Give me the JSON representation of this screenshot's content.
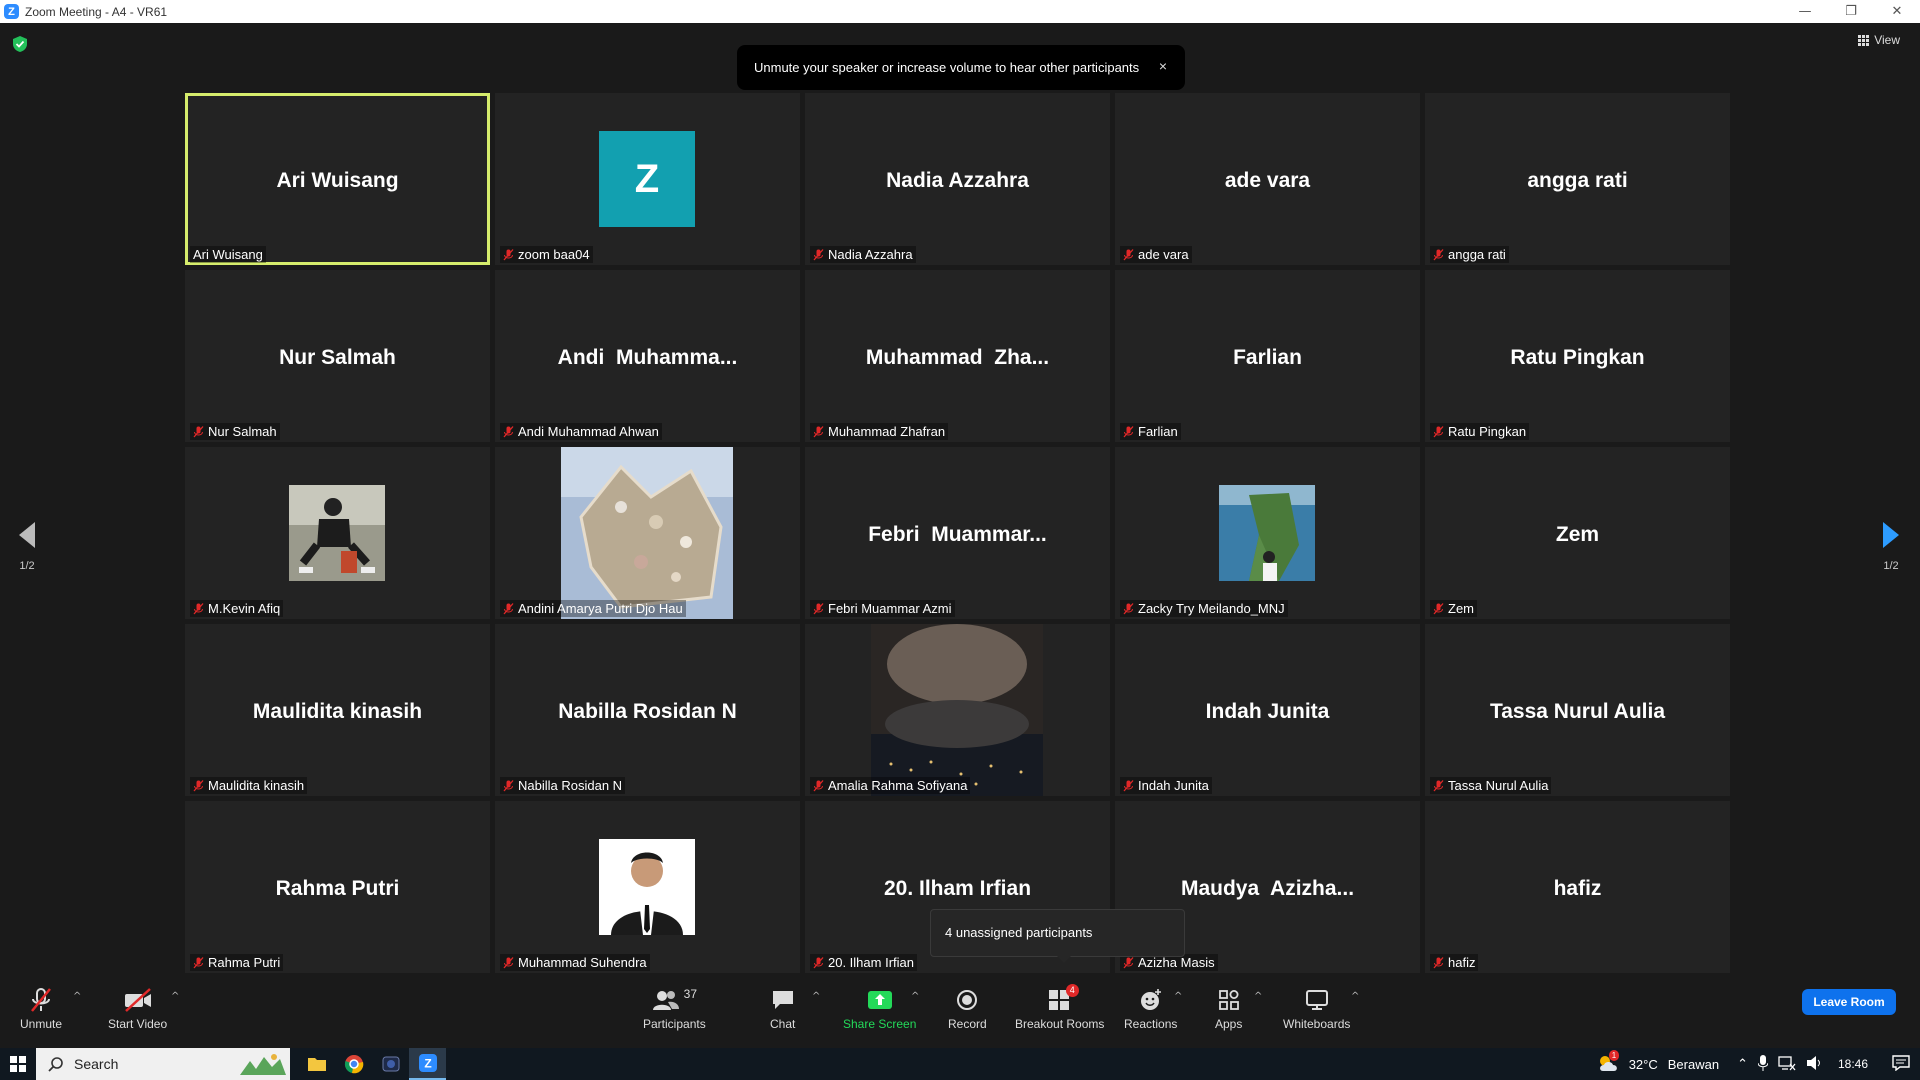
{
  "window": {
    "title": "Zoom Meeting - A4 - VR61",
    "controls": [
      "minimize",
      "restore",
      "close"
    ]
  },
  "view_button": {
    "label": "View"
  },
  "toast": {
    "message": "Unmute your speaker or increase volume to hear other participants",
    "close_glyph": "×"
  },
  "pager": {
    "left": "1/2",
    "right": "1/2"
  },
  "tiles": [
    {
      "display": "Ari Wuisang",
      "label": "Ari Wuisang",
      "muted": false,
      "active": true,
      "kind": "name"
    },
    {
      "display": "Z",
      "label": "zoom baa04",
      "muted": true,
      "kind": "letter"
    },
    {
      "display": "Nadia Azzahra",
      "label": "Nadia Azzahra",
      "muted": true,
      "kind": "name"
    },
    {
      "display": "ade vara",
      "label": "ade vara",
      "muted": true,
      "kind": "name"
    },
    {
      "display": "angga rati",
      "label": "angga rati",
      "muted": true,
      "kind": "name"
    },
    {
      "display": "Nur Salmah",
      "label": "Nur Salmah",
      "muted": true,
      "kind": "name"
    },
    {
      "display": "Andi  Muhamma...",
      "label": "Andi Muhammad Ahwan",
      "muted": true,
      "kind": "name"
    },
    {
      "display": "Muhammad  Zha...",
      "label": "Muhammad Zhafran",
      "muted": true,
      "kind": "name"
    },
    {
      "display": "Farlian",
      "label": "Farlian",
      "muted": true,
      "kind": "name"
    },
    {
      "display": "Ratu Pingkan",
      "label": "Ratu Pingkan",
      "muted": true,
      "kind": "name"
    },
    {
      "display": "",
      "label": "M.Kevin Afiq",
      "muted": true,
      "kind": "photo",
      "photo": "person-sitting"
    },
    {
      "display": "",
      "label": "Andini Amarya Putri Djo Hau",
      "muted": true,
      "kind": "photo",
      "photo": "crown"
    },
    {
      "display": "Febri  Muammar...",
      "label": "Febri Muammar Azmi",
      "muted": true,
      "kind": "name"
    },
    {
      "display": "",
      "label": "Zacky Try Meilando_MNJ",
      "muted": true,
      "kind": "photo",
      "photo": "cliff"
    },
    {
      "display": "Zem",
      "label": "Zem",
      "muted": true,
      "kind": "name"
    },
    {
      "display": "Maulidita kinasih",
      "label": "Maulidita kinasih",
      "muted": true,
      "kind": "name"
    },
    {
      "display": "Nabilla Rosidan N",
      "label": "Nabilla Rosidan N",
      "muted": true,
      "kind": "name"
    },
    {
      "display": "",
      "label": "Amalia Rahma Sofiyana",
      "muted": true,
      "kind": "photo",
      "photo": "night-city"
    },
    {
      "display": "Indah Junita",
      "label": "Indah Junita",
      "muted": true,
      "kind": "name"
    },
    {
      "display": "Tassa Nurul Aulia",
      "label": "Tassa Nurul Aulia",
      "muted": true,
      "kind": "name"
    },
    {
      "display": "Rahma Putri",
      "label": "Rahma Putri",
      "muted": true,
      "kind": "name"
    },
    {
      "display": "",
      "label": "Muhammad Suhendra",
      "muted": true,
      "kind": "photo",
      "photo": "portrait-suit"
    },
    {
      "display": "20. Ilham Irfian",
      "label": "20. Ilham Irfian",
      "muted": true,
      "kind": "name"
    },
    {
      "display": "Maudya  Azizha...",
      "label": "Azizha Masis",
      "muted": true,
      "kind": "name"
    },
    {
      "display": "hafiz",
      "label": "hafiz",
      "muted": true,
      "kind": "name"
    }
  ],
  "tooltip": {
    "text": "4 unassigned participants"
  },
  "toolbar": {
    "unmute": "Unmute",
    "start_video": "Start Video",
    "participants": "Participants",
    "participants_count": "37",
    "chat": "Chat",
    "share_screen": "Share Screen",
    "record": "Record",
    "breakout_rooms": "Breakout Rooms",
    "breakout_badge": "4",
    "reactions": "Reactions",
    "apps": "Apps",
    "whiteboards": "Whiteboards",
    "leave": "Leave Room"
  },
  "taskbar": {
    "search_label": "Search",
    "weather_temp": "32°C",
    "weather_text": "Berawan",
    "weather_badge": "1",
    "clock": "18:46"
  },
  "colors": {
    "active_speaker": "#d5ec6c",
    "share_screen_green": "#23d959",
    "leave_blue": "#0e72ed",
    "muted_red": "#e02828",
    "letter_avatar": "#12a0b0"
  }
}
